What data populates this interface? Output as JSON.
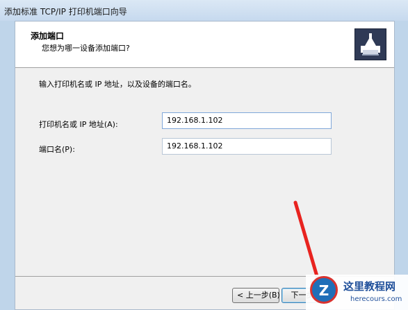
{
  "window": {
    "title": "添加标准 TCP/IP 打印机端口向导"
  },
  "header": {
    "title": "添加端口",
    "subtitle": "您想为哪一设备添加端口?",
    "icon": "printer-icon"
  },
  "main": {
    "instruction": "输入打印机名或 IP 地址，以及设备的端口名。",
    "fields": [
      {
        "label": "打印机名或 IP 地址(A):",
        "value": "192.168.1.102"
      },
      {
        "label": "端口名(P):",
        "value": "192.168.1.102"
      }
    ]
  },
  "footer": {
    "back_label": "< 上一步(B)",
    "next_label": "下一步"
  },
  "watermark": {
    "logo_letter": "Z",
    "site_name": "这里教程网",
    "domain": "herecours.com"
  },
  "colors": {
    "accent_arrow": "#e8231f",
    "header_icon_bg": "#2f3a56",
    "input_focus_border": "#7fa7d9"
  }
}
